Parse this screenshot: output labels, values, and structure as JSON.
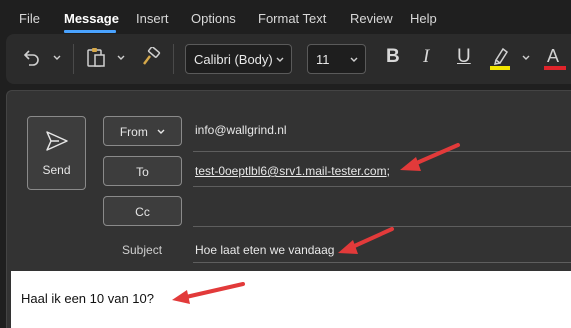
{
  "menu": {
    "tabs": [
      {
        "label": "File"
      },
      {
        "label": "Message"
      },
      {
        "label": "Insert"
      },
      {
        "label": "Options"
      },
      {
        "label": "Format Text"
      },
      {
        "label": "Review"
      },
      {
        "label": "Help"
      }
    ],
    "active": "Message"
  },
  "ribbon": {
    "icons": [
      "undo-icon",
      "clipboard-paste-icon",
      "format-painter-icon",
      "highlighter-icon",
      "font-color-icon"
    ],
    "font_name": "Calibri (Body)",
    "font_size": "11",
    "bold": "B",
    "italic": "I",
    "underline": "U",
    "font_color_glyph": "A",
    "highlight_color": "#f2e600",
    "font_color": "#e0242b"
  },
  "compose": {
    "send_label": "Send",
    "from_label": "From",
    "from_value": "info@wallgrind.nl",
    "to_label": "To",
    "to_value": "test-0oeptlbl6@srv1.mail-tester.com",
    "to_separator": ";",
    "cc_label": "Cc",
    "subject_label": "Subject",
    "subject_value": "Hoe laat eten we vandaag"
  },
  "body": {
    "text": "Haal ik een 10 van 10?"
  },
  "colors": {
    "accent": "#4aa3ff",
    "annotation_arrow": "#e23a3a"
  }
}
